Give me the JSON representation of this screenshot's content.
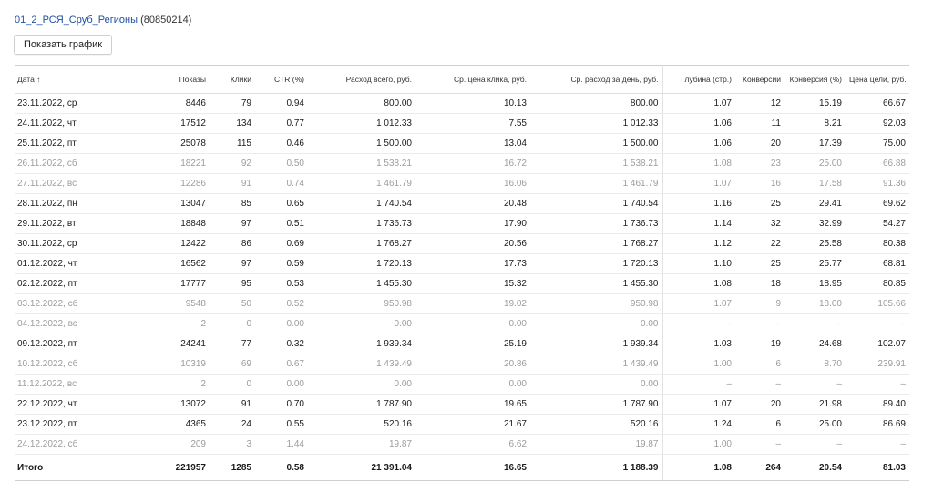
{
  "header": {
    "campaign_name": "01_2_РСЯ_Сруб_Регионы",
    "campaign_id": "(80850214)",
    "chart_button": "Показать график"
  },
  "table": {
    "columns": {
      "date": "Дата",
      "sort_indicator": "↑",
      "impressions": "Показы",
      "clicks": "Клики",
      "ctr": "CTR (%)",
      "spend_total": "Расход всего, руб.",
      "avg_cpc": "Ср. цена клика, руб.",
      "avg_daily_spend": "Ср. расход за день, руб.",
      "depth": "Глубина (стр.)",
      "conversions": "Конверсии",
      "conv_rate": "Конверсия (%)",
      "cost_per_goal": "Цена цели, руб."
    },
    "rows": [
      {
        "date": "23.11.2022, ср",
        "impressions": "8446",
        "clicks": "79",
        "ctr": "0.94",
        "spend_total": "800.00",
        "avg_cpc": "10.13",
        "avg_daily_spend": "800.00",
        "depth": "1.07",
        "conversions": "12",
        "conv_rate": "15.19",
        "cost_per_goal": "66.67",
        "muted": false
      },
      {
        "date": "24.11.2022, чт",
        "impressions": "17512",
        "clicks": "134",
        "ctr": "0.77",
        "spend_total": "1 012.33",
        "avg_cpc": "7.55",
        "avg_daily_spend": "1 012.33",
        "depth": "1.06",
        "conversions": "11",
        "conv_rate": "8.21",
        "cost_per_goal": "92.03",
        "muted": false
      },
      {
        "date": "25.11.2022, пт",
        "impressions": "25078",
        "clicks": "115",
        "ctr": "0.46",
        "spend_total": "1 500.00",
        "avg_cpc": "13.04",
        "avg_daily_spend": "1 500.00",
        "depth": "1.06",
        "conversions": "20",
        "conv_rate": "17.39",
        "cost_per_goal": "75.00",
        "muted": false
      },
      {
        "date": "26.11.2022, сб",
        "impressions": "18221",
        "clicks": "92",
        "ctr": "0.50",
        "spend_total": "1 538.21",
        "avg_cpc": "16.72",
        "avg_daily_spend": "1 538.21",
        "depth": "1.08",
        "conversions": "23",
        "conv_rate": "25.00",
        "cost_per_goal": "66.88",
        "muted": true
      },
      {
        "date": "27.11.2022, вс",
        "impressions": "12286",
        "clicks": "91",
        "ctr": "0.74",
        "spend_total": "1 461.79",
        "avg_cpc": "16.06",
        "avg_daily_spend": "1 461.79",
        "depth": "1.07",
        "conversions": "16",
        "conv_rate": "17.58",
        "cost_per_goal": "91.36",
        "muted": true
      },
      {
        "date": "28.11.2022, пн",
        "impressions": "13047",
        "clicks": "85",
        "ctr": "0.65",
        "spend_total": "1 740.54",
        "avg_cpc": "20.48",
        "avg_daily_spend": "1 740.54",
        "depth": "1.16",
        "conversions": "25",
        "conv_rate": "29.41",
        "cost_per_goal": "69.62",
        "muted": false
      },
      {
        "date": "29.11.2022, вт",
        "impressions": "18848",
        "clicks": "97",
        "ctr": "0.51",
        "spend_total": "1 736.73",
        "avg_cpc": "17.90",
        "avg_daily_spend": "1 736.73",
        "depth": "1.14",
        "conversions": "32",
        "conv_rate": "32.99",
        "cost_per_goal": "54.27",
        "muted": false
      },
      {
        "date": "30.11.2022, ср",
        "impressions": "12422",
        "clicks": "86",
        "ctr": "0.69",
        "spend_total": "1 768.27",
        "avg_cpc": "20.56",
        "avg_daily_spend": "1 768.27",
        "depth": "1.12",
        "conversions": "22",
        "conv_rate": "25.58",
        "cost_per_goal": "80.38",
        "muted": false
      },
      {
        "date": "01.12.2022, чт",
        "impressions": "16562",
        "clicks": "97",
        "ctr": "0.59",
        "spend_total": "1 720.13",
        "avg_cpc": "17.73",
        "avg_daily_spend": "1 720.13",
        "depth": "1.10",
        "conversions": "25",
        "conv_rate": "25.77",
        "cost_per_goal": "68.81",
        "muted": false
      },
      {
        "date": "02.12.2022, пт",
        "impressions": "17777",
        "clicks": "95",
        "ctr": "0.53",
        "spend_total": "1 455.30",
        "avg_cpc": "15.32",
        "avg_daily_spend": "1 455.30",
        "depth": "1.08",
        "conversions": "18",
        "conv_rate": "18.95",
        "cost_per_goal": "80.85",
        "muted": false
      },
      {
        "date": "03.12.2022, сб",
        "impressions": "9548",
        "clicks": "50",
        "ctr": "0.52",
        "spend_total": "950.98",
        "avg_cpc": "19.02",
        "avg_daily_spend": "950.98",
        "depth": "1.07",
        "conversions": "9",
        "conv_rate": "18.00",
        "cost_per_goal": "105.66",
        "muted": true
      },
      {
        "date": "04.12.2022, вс",
        "impressions": "2",
        "clicks": "0",
        "ctr": "0.00",
        "spend_total": "0.00",
        "avg_cpc": "0.00",
        "avg_daily_spend": "0.00",
        "depth": "–",
        "conversions": "–",
        "conv_rate": "–",
        "cost_per_goal": "–",
        "muted": true
      },
      {
        "date": "09.12.2022, пт",
        "impressions": "24241",
        "clicks": "77",
        "ctr": "0.32",
        "spend_total": "1 939.34",
        "avg_cpc": "25.19",
        "avg_daily_spend": "1 939.34",
        "depth": "1.03",
        "conversions": "19",
        "conv_rate": "24.68",
        "cost_per_goal": "102.07",
        "muted": false
      },
      {
        "date": "10.12.2022, сб",
        "impressions": "10319",
        "clicks": "69",
        "ctr": "0.67",
        "spend_total": "1 439.49",
        "avg_cpc": "20.86",
        "avg_daily_spend": "1 439.49",
        "depth": "1.00",
        "conversions": "6",
        "conv_rate": "8.70",
        "cost_per_goal": "239.91",
        "muted": true
      },
      {
        "date": "11.12.2022, вс",
        "impressions": "2",
        "clicks": "0",
        "ctr": "0.00",
        "spend_total": "0.00",
        "avg_cpc": "0.00",
        "avg_daily_spend": "0.00",
        "depth": "–",
        "conversions": "–",
        "conv_rate": "–",
        "cost_per_goal": "–",
        "muted": true
      },
      {
        "date": "22.12.2022, чт",
        "impressions": "13072",
        "clicks": "91",
        "ctr": "0.70",
        "spend_total": "1 787.90",
        "avg_cpc": "19.65",
        "avg_daily_spend": "1 787.90",
        "depth": "1.07",
        "conversions": "20",
        "conv_rate": "21.98",
        "cost_per_goal": "89.40",
        "muted": false
      },
      {
        "date": "23.12.2022, пт",
        "impressions": "4365",
        "clicks": "24",
        "ctr": "0.55",
        "spend_total": "520.16",
        "avg_cpc": "21.67",
        "avg_daily_spend": "520.16",
        "depth": "1.24",
        "conversions": "6",
        "conv_rate": "25.00",
        "cost_per_goal": "86.69",
        "muted": false
      },
      {
        "date": "24.12.2022, сб",
        "impressions": "209",
        "clicks": "3",
        "ctr": "1.44",
        "spend_total": "19.87",
        "avg_cpc": "6.62",
        "avg_daily_spend": "19.87",
        "depth": "1.00",
        "conversions": "–",
        "conv_rate": "–",
        "cost_per_goal": "–",
        "muted": true
      }
    ],
    "total": {
      "date": "Итого",
      "impressions": "221957",
      "clicks": "1285",
      "ctr": "0.58",
      "spend_total": "21 391.04",
      "avg_cpc": "16.65",
      "avg_daily_spend": "1 188.39",
      "depth": "1.08",
      "conversions": "264",
      "conv_rate": "20.54",
      "cost_per_goal": "81.03"
    }
  }
}
